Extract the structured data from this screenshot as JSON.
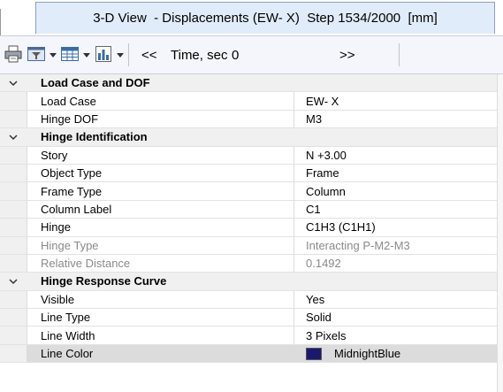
{
  "tab": {
    "title": "3-D View  - Displacements (EW- X)  Step 1534/2000  [mm]"
  },
  "toolbar": {
    "prev_label": "<<",
    "time_label": "Time, sec",
    "time_value": "0",
    "next_label": ">>",
    "icons": [
      "printer-icon",
      "display-options-icon",
      "table-icon",
      "chart-icon"
    ]
  },
  "grid": {
    "load_case": {
      "title": "Load Case and DOF",
      "rows": [
        {
          "label": "Load Case",
          "value": "EW- X"
        },
        {
          "label": "Hinge DOF",
          "value": "M3"
        }
      ]
    },
    "hinge_id": {
      "title": "Hinge Identification",
      "rows": [
        {
          "label": "Story",
          "value": "N +3.00"
        },
        {
          "label": "Object Type",
          "value": "Frame"
        },
        {
          "label": "Frame Type",
          "value": "Column"
        },
        {
          "label": "Column Label",
          "value": "C1"
        },
        {
          "label": "Hinge",
          "value": "C1H3 (C1H1)"
        },
        {
          "label": "Hinge Type",
          "value": "Interacting P-M2-M3"
        },
        {
          "label": "Relative Distance",
          "value": "0.1492"
        }
      ]
    },
    "response_curve": {
      "title": "Hinge Response Curve",
      "rows": [
        {
          "label": "Visible",
          "value": "Yes"
        },
        {
          "label": "Line Type",
          "value": "Solid"
        },
        {
          "label": "Line Width",
          "value": "3 Pixels"
        },
        {
          "label": "Line Color",
          "value": "MidnightBlue"
        }
      ]
    }
  },
  "colors": {
    "line_color_swatch": "#191970",
    "tab_bg": "#e1ecfa"
  }
}
